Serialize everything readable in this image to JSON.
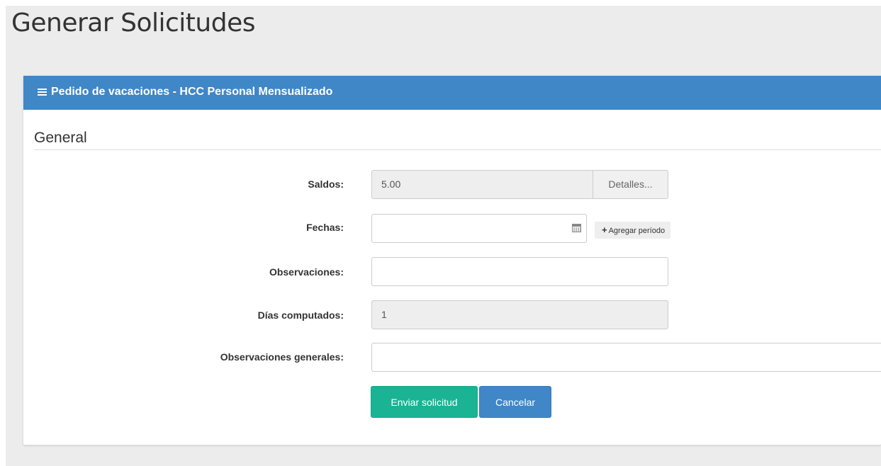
{
  "page": {
    "title": "Generar Solicitudes"
  },
  "panel": {
    "header_title": "Pedido de vacaciones - HCC Personal Mensualizado",
    "section_title": "General"
  },
  "form": {
    "saldos": {
      "label": "Saldos:",
      "value": "5.00",
      "details_button": "Detalles..."
    },
    "fechas": {
      "label": "Fechas:",
      "value": "",
      "add_period_button": "Agregar período"
    },
    "observaciones": {
      "label": "Observaciones:",
      "value": ""
    },
    "dias_computados": {
      "label": "Días computados:",
      "value": "1"
    },
    "observaciones_generales": {
      "label": "Observaciones generales:",
      "value": ""
    }
  },
  "actions": {
    "submit_label": "Enviar solicitud",
    "cancel_label": "Cancelar"
  },
  "icons": {
    "header": "menu-icon",
    "calendar": "calendar-icon",
    "plus": "plus-icon"
  },
  "colors": {
    "header_blue": "#3f87c7",
    "submit_green": "#1ab394",
    "cancel_blue": "#3f87c7",
    "background": "#ececec"
  }
}
